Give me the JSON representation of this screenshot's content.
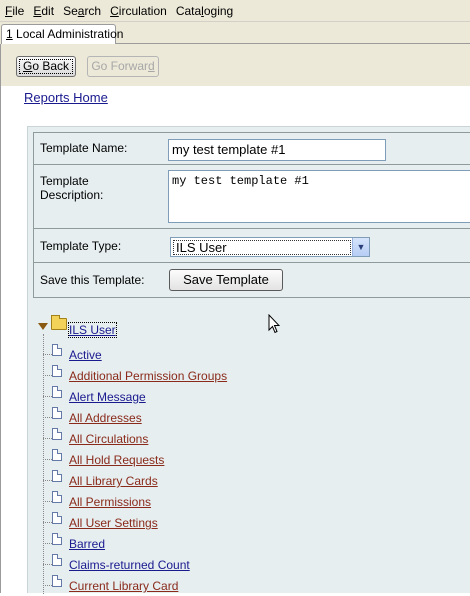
{
  "menu": [
    {
      "pre": "",
      "u": "F",
      "post": "ile"
    },
    {
      "pre": "",
      "u": "E",
      "post": "dit"
    },
    {
      "pre": "Se",
      "u": "a",
      "post": "rch"
    },
    {
      "pre": "",
      "u": "C",
      "post": "irculation"
    },
    {
      "pre": "Cata",
      "u": "l",
      "post": "oging"
    }
  ],
  "tab": {
    "number": "1",
    "label": " Local Administration"
  },
  "toolbar": {
    "back": {
      "pre": "",
      "u": "G",
      "post": "o Back"
    },
    "forward": {
      "pre": "Go Forwar",
      "u": "d",
      "post": ""
    }
  },
  "reports_home": "Reports Home",
  "form": {
    "name_label": "Template Name:",
    "name_value": "my test template #1",
    "desc_label": "Template Description:",
    "desc_value": "my test template #1",
    "type_label": "Template Type:",
    "type_value": "ILS User",
    "save_label": "Save this Template:",
    "save_button": "Save Template"
  },
  "tree": {
    "root": "ILS User",
    "items": [
      {
        "label": "Active",
        "color": "#1a1a8f"
      },
      {
        "label": "Additional Permission Groups",
        "color": "#8a2a1a"
      },
      {
        "label": "Alert Message",
        "color": "#1a1a8f"
      },
      {
        "label": "All Addresses",
        "color": "#8a2a1a"
      },
      {
        "label": "All Circulations",
        "color": "#8a2a1a"
      },
      {
        "label": "All Hold Requests",
        "color": "#8a2a1a"
      },
      {
        "label": "All Library Cards",
        "color": "#8a2a1a"
      },
      {
        "label": "All Permissions",
        "color": "#8a2a1a"
      },
      {
        "label": "All User Settings",
        "color": "#8a2a1a"
      },
      {
        "label": "Barred",
        "color": "#1a1a8f"
      },
      {
        "label": "Claims-returned Count",
        "color": "#1a1a8f"
      },
      {
        "label": "Current Library Card",
        "color": "#8a2a1a"
      }
    ]
  },
  "icons": [
    "triangle-expanded-icon",
    "folder-icon",
    "document-icon",
    "chevron-down-icon",
    "mouse-pointer-icon"
  ]
}
